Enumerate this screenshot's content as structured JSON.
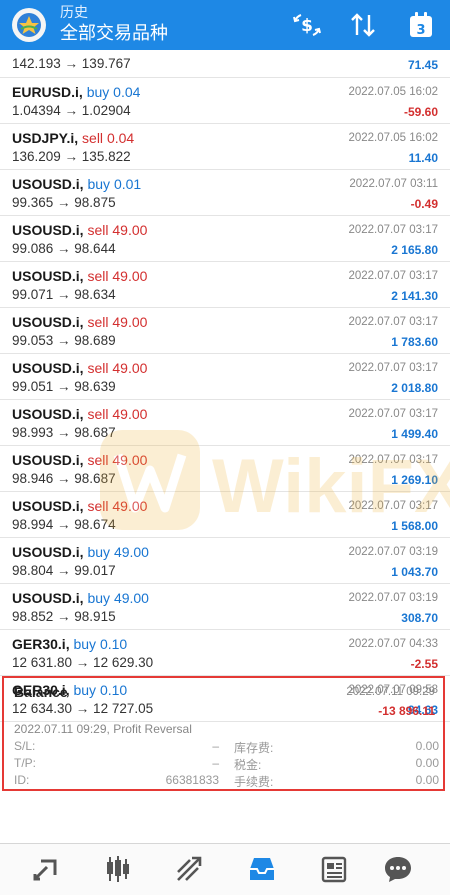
{
  "header": {
    "title": "历史",
    "subtitle": "全部交易品种",
    "calendar_day": "3"
  },
  "rows": [
    {
      "symbol": "",
      "dir": "",
      "vol": "",
      "prices": "142.193 → 139.767",
      "time": "",
      "profit": "71.45",
      "sign": "pos"
    },
    {
      "symbol": "EURUSD.i,",
      "dir": "buy",
      "vol": "0.04",
      "prices": "1.04394 → 1.02904",
      "time": "2022.07.05 16:02",
      "profit": "-59.60",
      "sign": "neg"
    },
    {
      "symbol": "USDJPY.i,",
      "dir": "sell",
      "vol": "0.04",
      "prices": "136.209 → 135.822",
      "time": "2022.07.05 16:02",
      "profit": "11.40",
      "sign": "pos"
    },
    {
      "symbol": "USOUSD.i,",
      "dir": "buy",
      "vol": "0.01",
      "prices": "99.365 → 98.875",
      "time": "2022.07.07 03:11",
      "profit": "-0.49",
      "sign": "neg"
    },
    {
      "symbol": "USOUSD.i,",
      "dir": "sell",
      "vol": "49.00",
      "prices": "99.086 → 98.644",
      "time": "2022.07.07 03:17",
      "profit": "2 165.80",
      "sign": "pos"
    },
    {
      "symbol": "USOUSD.i,",
      "dir": "sell",
      "vol": "49.00",
      "prices": "99.071 → 98.634",
      "time": "2022.07.07 03:17",
      "profit": "2 141.30",
      "sign": "pos"
    },
    {
      "symbol": "USOUSD.i,",
      "dir": "sell",
      "vol": "49.00",
      "prices": "99.053 → 98.689",
      "time": "2022.07.07 03:17",
      "profit": "1 783.60",
      "sign": "pos"
    },
    {
      "symbol": "USOUSD.i,",
      "dir": "sell",
      "vol": "49.00",
      "prices": "99.051 → 98.639",
      "time": "2022.07.07 03:17",
      "profit": "2 018.80",
      "sign": "pos"
    },
    {
      "symbol": "USOUSD.i,",
      "dir": "sell",
      "vol": "49.00",
      "prices": "98.993 → 98.687",
      "time": "2022.07.07 03:17",
      "profit": "1 499.40",
      "sign": "pos"
    },
    {
      "symbol": "USOUSD.i,",
      "dir": "sell",
      "vol": "49.00",
      "prices": "98.946 → 98.687",
      "time": "2022.07.07 03:17",
      "profit": "1 269.10",
      "sign": "pos"
    },
    {
      "symbol": "USOUSD.i,",
      "dir": "sell",
      "vol": "49.00",
      "prices": "98.994 → 98.674",
      "time": "2022.07.07 03:17",
      "profit": "1 568.00",
      "sign": "pos"
    },
    {
      "symbol": "USOUSD.i,",
      "dir": "buy",
      "vol": "49.00",
      "prices": "98.804 → 99.017",
      "time": "2022.07.07 03:19",
      "profit": "1 043.70",
      "sign": "pos"
    },
    {
      "symbol": "USOUSD.i,",
      "dir": "buy",
      "vol": "49.00",
      "prices": "98.852 → 98.915",
      "time": "2022.07.07 03:19",
      "profit": "308.70",
      "sign": "pos"
    },
    {
      "symbol": "GER30.i,",
      "dir": "buy",
      "vol": "0.10",
      "prices": "12 631.80 → 12 629.30",
      "time": "2022.07.07 04:33",
      "profit": "-2.55",
      "sign": "neg"
    },
    {
      "symbol": "GER30.i,",
      "dir": "buy",
      "vol": "0.10",
      "prices": "12 634.30 → 12 727.05",
      "time": "2022.07.07 09:58",
      "profit": "94.63",
      "sign": "pos"
    }
  ],
  "balance": {
    "title": "Balance",
    "time": "2022.07.11 09:29",
    "amount": "-13 896.11",
    "comment": "2022.07.11 09:29, Profit Reversal",
    "sl_label": "S/L:",
    "sl_value": "–",
    "swap_label": "库存费:",
    "swap_value": "0.00",
    "tp_label": "T/P:",
    "tp_value": "–",
    "tax_label": "税金:",
    "tax_value": "0.00",
    "id_label": "ID:",
    "id_value": "66381833",
    "fee_label": "手续费:",
    "fee_value": "0.00"
  },
  "watermark": {
    "text": "WikiFX"
  },
  "colors": {
    "accent": "#1e88e5",
    "buy": "#1976d2",
    "sell": "#d32f2f",
    "highlight_border": "#e53935"
  }
}
